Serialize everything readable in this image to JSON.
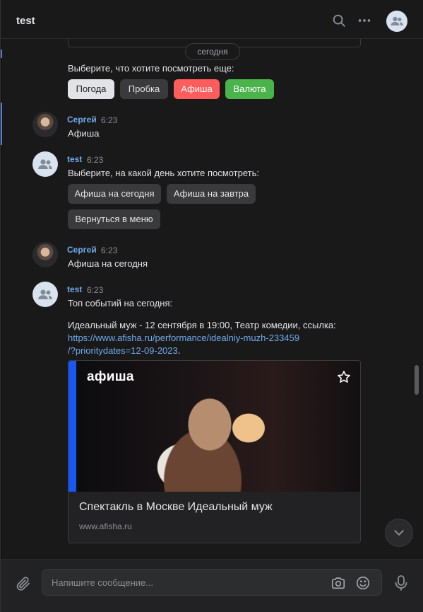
{
  "header": {
    "title": "test"
  },
  "date_separator": "сегодня",
  "messages": {
    "m0": {
      "text": "Выберите, что хотите посмотреть еще:",
      "buttons": [
        "Погода",
        "Пробка",
        "Афиша",
        "Валюта"
      ]
    },
    "m1": {
      "author": "Сергей",
      "time": "6:23",
      "text": "Афиша"
    },
    "m2": {
      "author": "test",
      "time": "6:23",
      "text": "Выберите, на какой день хотите посмотреть:",
      "buttons": [
        "Афиша на сегодня",
        "Афиша на завтра",
        "Вернуться в меню"
      ]
    },
    "m3": {
      "author": "Сергей",
      "time": "6:23",
      "text": "Афиша на сегодня"
    },
    "m4": {
      "author": "test",
      "time": "6:23",
      "text": "Топ событий на сегодня:",
      "line2": "Идеальный муж - 12 сентября в 19:00, Театр комедии, ссылка:",
      "link_line1": "https://www.afisha.ru/performance/idealniy-muzh-233459",
      "link_line2": "/?prioritydates=12-09-2023",
      "link_trail": ".",
      "card": {
        "brand": "афиша",
        "title": "Спектакль в Москве Идеальный муж",
        "domain": "www.afisha.ru"
      }
    }
  },
  "composer": {
    "placeholder": "Напишите сообщение..."
  },
  "colors": {
    "background": "#19191a",
    "accent_link": "#71aaeb",
    "button_red": "#ff5c5c",
    "button_green": "#4bb34b",
    "brand_blue": "#1a56f2"
  },
  "icons": [
    "search-icon",
    "more-icon",
    "chat-avatar-icon",
    "star-icon",
    "scroll-down-icon",
    "attach-icon",
    "camera-icon",
    "emoji-icon",
    "microphone-icon"
  ]
}
